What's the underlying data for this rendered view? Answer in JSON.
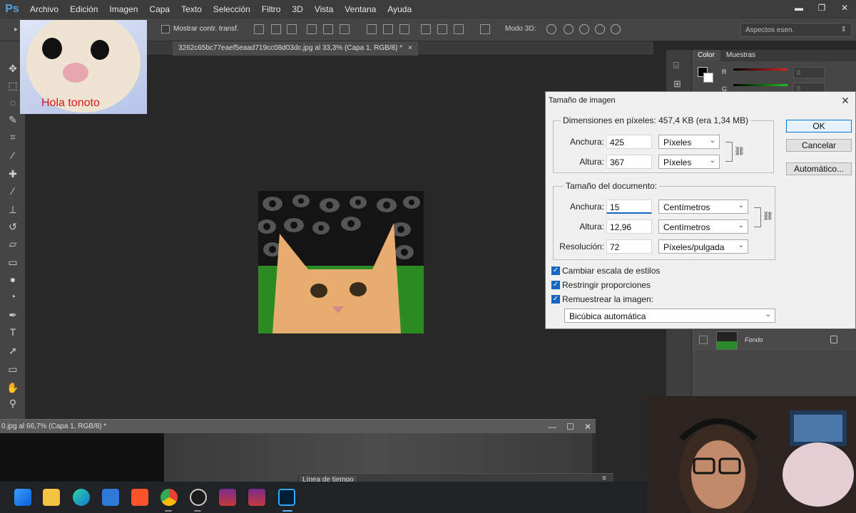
{
  "menubar": {
    "logo": "Ps",
    "items": [
      "Archivo",
      "Edición",
      "Imagen",
      "Capa",
      "Texto",
      "Selección",
      "Filtro",
      "3D",
      "Vista",
      "Ventana",
      "Ayuda"
    ]
  },
  "options_bar": {
    "show_transform_label": "Mostrar contr. transf.",
    "mode3d_label": "Modo 3D:",
    "workspace_value": "Aspectos esen."
  },
  "document": {
    "tab_title": "3262c65bc77eaef5eaad719cc08d03dc.jpg al 33,3% (Capa 1, RGB/8) *",
    "tab_close": "×"
  },
  "webcam_overlay": {
    "caption": "Hola tonoto"
  },
  "right_panel": {
    "tabs": [
      "Color",
      "Muestras"
    ],
    "channel_r": "R",
    "channel_g": "G",
    "channel_r_value": "0",
    "channel_g_value": "0",
    "layer_name": "Fondo"
  },
  "dialog": {
    "title": "Tamaño de imagen",
    "pixel_dimensions_legend": "Dimensiones en píxeles: 457,4 KB (era 1,34 MB)",
    "width_label": "Anchura:",
    "height_label": "Altura:",
    "px_width_value": "425",
    "px_height_value": "367",
    "px_unit": "Píxeles",
    "document_size_legend": "Tamaño del documento:",
    "doc_width_value": "15",
    "doc_height_value": "12,96",
    "doc_unit": "Centímetros",
    "resolution_label": "Resolución:",
    "resolution_value": "72",
    "resolution_unit": "Píxeles/pulgada",
    "checkboxes": [
      {
        "label": "Cambiar escala de estilos",
        "checked": true
      },
      {
        "label": "Restringir proporciones",
        "checked": true
      },
      {
        "label": "Remuestrear la imagen:",
        "checked": true
      }
    ],
    "resample_method": "Bicúbica automática",
    "ok_label": "OK",
    "cancel_label": "Cancelar",
    "auto_label": "Automático..."
  },
  "document2": {
    "tab_title": "0.jpg al 66,7% (Capa 1, RGB/8) *",
    "timeline_label": "Línea de tiempo"
  },
  "taskbar": {
    "apps": [
      "windows-start",
      "file-explorer",
      "edge",
      "store",
      "brave",
      "chrome",
      "obs",
      "winrar",
      "winrar-2",
      "photoshop"
    ]
  }
}
